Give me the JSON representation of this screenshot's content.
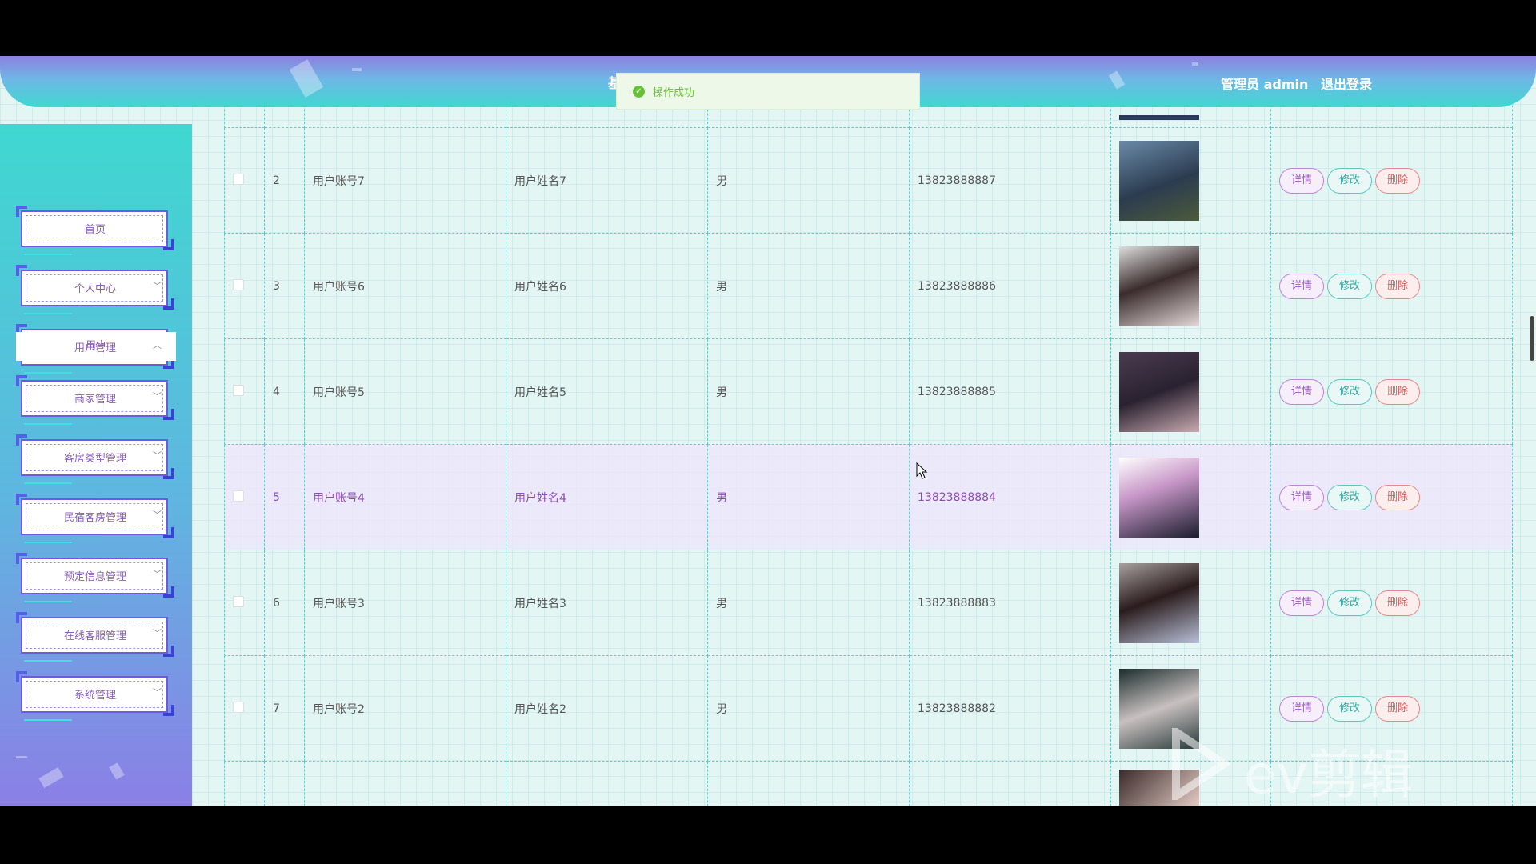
{
  "header": {
    "title": "基",
    "user_label": "管理员 admin",
    "logout": "退出登录",
    "toast": "操作成功"
  },
  "sidebar": {
    "items": [
      {
        "label": "首页"
      },
      {
        "label": "个人中心"
      },
      {
        "label": "用户管理"
      },
      {
        "label": "商家管理"
      },
      {
        "label": "客房类型管理"
      },
      {
        "label": "民宿客房管理"
      },
      {
        "label": "预定信息管理"
      },
      {
        "label": "在线客服管理"
      },
      {
        "label": "系统管理"
      }
    ],
    "sub_item": "用户"
  },
  "table": {
    "rows": [
      {
        "index": "2",
        "account": "用户账号7",
        "name": "用户姓名7",
        "gender": "男",
        "phone": "13823888887"
      },
      {
        "index": "3",
        "account": "用户账号6",
        "name": "用户姓名6",
        "gender": "男",
        "phone": "13823888886"
      },
      {
        "index": "4",
        "account": "用户账号5",
        "name": "用户姓名5",
        "gender": "男",
        "phone": "13823888885"
      },
      {
        "index": "5",
        "account": "用户账号4",
        "name": "用户姓名4",
        "gender": "男",
        "phone": "13823888884"
      },
      {
        "index": "6",
        "account": "用户账号3",
        "name": "用户姓名3",
        "gender": "男",
        "phone": "13823888883"
      },
      {
        "index": "7",
        "account": "用户账号2",
        "name": "用户姓名2",
        "gender": "男",
        "phone": "13823888882"
      }
    ],
    "actions": {
      "detail": "详情",
      "edit": "修改",
      "delete": "删除"
    }
  },
  "watermark": "ev剪辑",
  "colors": {
    "accent": "#8c5fbf",
    "header_top": "#8e7fe0",
    "header_bottom": "#3fd8d2"
  }
}
